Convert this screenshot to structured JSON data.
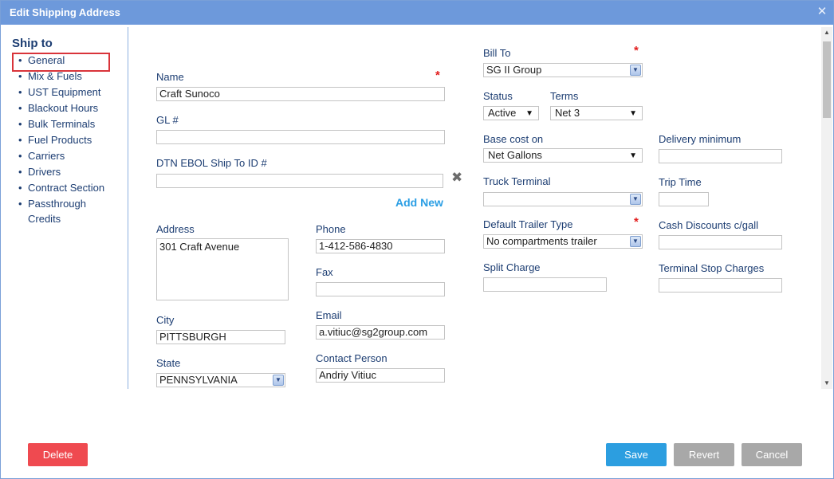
{
  "window": {
    "title": "Edit Shipping Address"
  },
  "sidebar": {
    "title": "Ship to",
    "items": [
      {
        "label": "General"
      },
      {
        "label": "Mix & Fuels"
      },
      {
        "label": "UST Equipment"
      },
      {
        "label": "Blackout Hours"
      },
      {
        "label": "Bulk Terminals"
      },
      {
        "label": "Fuel Products"
      },
      {
        "label": "Carriers"
      },
      {
        "label": "Drivers"
      },
      {
        "label": "Contract Section"
      },
      {
        "label": "Passthrough Credits"
      }
    ],
    "active_item": "General"
  },
  "form": {
    "name": {
      "label": "Name",
      "value": "Craft Sunoco"
    },
    "gl": {
      "label": "GL #",
      "value": ""
    },
    "dtn": {
      "label": "DTN EBOL Ship To ID #",
      "value": ""
    },
    "add_new": "Add New",
    "address": {
      "label": "Address",
      "value": "301 Craft Avenue"
    },
    "phone": {
      "label": "Phone",
      "value": "1-412-586-4830"
    },
    "fax": {
      "label": "Fax",
      "value": ""
    },
    "city": {
      "label": "City",
      "value": "PITTSBURGH"
    },
    "email": {
      "label": "Email",
      "value": "a.vitiuc@sg2group.com"
    },
    "state": {
      "label": "State",
      "value": "PENNSYLVANIA"
    },
    "contact": {
      "label": "Contact Person",
      "value": "Andriy Vitiuc"
    },
    "bill_to": {
      "label": "Bill To",
      "value": "SG II Group"
    },
    "status": {
      "label": "Status",
      "value": "Active"
    },
    "terms": {
      "label": "Terms",
      "value": "Net 3"
    },
    "base_cost": {
      "label": "Base cost on",
      "value": "Net Gallons"
    },
    "delivery_min": {
      "label": "Delivery minimum",
      "value": ""
    },
    "truck_terminal": {
      "label": "Truck Terminal",
      "value": ""
    },
    "trip_time": {
      "label": "Trip Time",
      "value": ""
    },
    "trailer_type": {
      "label": "Default Trailer Type",
      "value": "No compartments trailer"
    },
    "cash_discounts": {
      "label": "Cash Discounts c/gall",
      "value": ""
    },
    "split_charge": {
      "label": "Split Charge",
      "value": ""
    },
    "terminal_stop": {
      "label": "Terminal Stop Charges",
      "value": ""
    }
  },
  "buttons": {
    "delete": "Delete",
    "save": "Save",
    "revert": "Revert",
    "cancel": "Cancel"
  },
  "colors": {
    "titlebar": "#6d99db",
    "required": "#e21c1c",
    "link": "#2a9ee4",
    "delete": "#ef4a50",
    "save": "#2c9ee0",
    "neutral": "#a8a8a8"
  }
}
